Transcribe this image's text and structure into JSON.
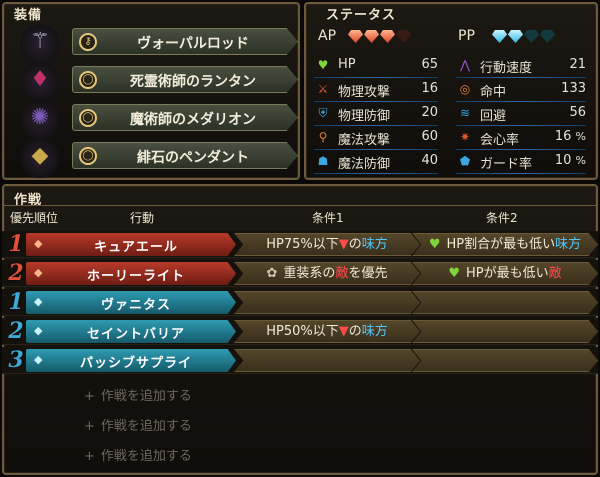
{
  "equipment": {
    "title": "装備",
    "items": [
      {
        "name": "ヴォーパルロッド",
        "icon": "wand-icon"
      },
      {
        "name": "死霊術師のランタン",
        "icon": "lantern-icon"
      },
      {
        "name": "魔術師のメダリオン",
        "icon": "medallion-icon"
      },
      {
        "name": "緋石のペンダント",
        "icon": "pendant-icon"
      }
    ]
  },
  "status": {
    "title": "ステータス",
    "ap_label": "AP",
    "pp_label": "PP",
    "ap_gems_filled": 3,
    "ap_gems_total": 4,
    "pp_gems_filled": 2,
    "pp_gems_total": 4,
    "left": [
      {
        "label": "HP",
        "value": "65",
        "icon": "heart-icon",
        "color": "#7ed63b"
      },
      {
        "label": "物理攻撃",
        "value": "16",
        "icon": "sword-icon",
        "color": "#e35b2c"
      },
      {
        "label": "物理防御",
        "value": "20",
        "icon": "armor-icon",
        "color": "#3aa7e0"
      },
      {
        "label": "魔法攻撃",
        "value": "60",
        "icon": "staff-icon",
        "color": "#e77f2e"
      },
      {
        "label": "魔法防御",
        "value": "40",
        "icon": "robe-icon",
        "color": "#3aa7e0"
      }
    ],
    "right": [
      {
        "label": "行動速度",
        "value": "21",
        "icon": "wing-icon",
        "color": "#9b5bdc"
      },
      {
        "label": "命中",
        "value": "133",
        "icon": "target-icon",
        "color": "#e77f2e"
      },
      {
        "label": "回避",
        "value": "56",
        "icon": "evasion-icon",
        "color": "#3aa7e0"
      },
      {
        "label": "会心率",
        "value": "16",
        "unit": "%",
        "icon": "critical-icon",
        "color": "#e35b2c"
      },
      {
        "label": "ガード率",
        "value": "10",
        "unit": "%",
        "icon": "shield-icon",
        "color": "#3aa7e0"
      }
    ]
  },
  "tactics": {
    "title": "作戦",
    "headers": {
      "priority": "優先順位",
      "action": "行動",
      "cond1": "条件1",
      "cond2": "条件2"
    },
    "rows": [
      {
        "num": "1",
        "action": "キュアエール",
        "type": "ap",
        "cond1": {
          "pre": "HP75%以下",
          "arrow": "▼",
          "mid": "の",
          "hl": "味方",
          "icon": ""
        },
        "cond2": {
          "pre": "HP割合が最も低い",
          "hl": "味方",
          "hlclass": "blue",
          "icon": "heart-icon"
        }
      },
      {
        "num": "2",
        "action": "ホーリーライト",
        "type": "ap",
        "cond1": {
          "pre": "重装系の",
          "hl": "敵",
          "post": "を優先",
          "icon": "heavy-armor-icon"
        },
        "cond2": {
          "pre": "HPが最も低い",
          "hl": "敵",
          "hlclass": "red",
          "icon": "heart-icon"
        }
      },
      {
        "num": "1",
        "action": "ヴァニタス",
        "type": "pp"
      },
      {
        "num": "2",
        "action": "セイントバリア",
        "type": "pp",
        "cond1": {
          "pre": "HP50%以下",
          "arrow": "▼",
          "mid": "の",
          "hl": "味方",
          "icon": ""
        }
      },
      {
        "num": "3",
        "action": "パッシブサプライ",
        "type": "pp"
      }
    ],
    "add_label": "作戦を追加する",
    "add_plus": "+"
  }
}
